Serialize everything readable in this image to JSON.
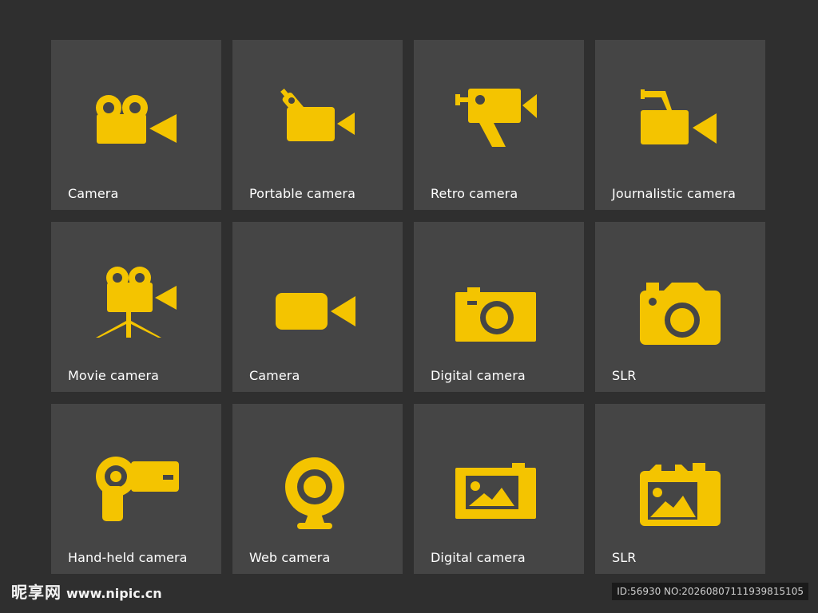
{
  "colors": {
    "background": "#2f2f2f",
    "tile": "#454545",
    "icon": "#f4c400",
    "label": "#ffffff"
  },
  "tiles": [
    {
      "label": "Camera",
      "icon": "movie-camera-icon"
    },
    {
      "label": "Portable camera",
      "icon": "portable-camera-icon"
    },
    {
      "label": "Retro camera",
      "icon": "retro-camera-icon"
    },
    {
      "label": "Journalistic camera",
      "icon": "journalistic-camera-icon"
    },
    {
      "label": "Movie camera",
      "icon": "movie-camera-tripod-icon"
    },
    {
      "label": "Camera",
      "icon": "video-camera-icon"
    },
    {
      "label": "Digital camera",
      "icon": "digital-camera-icon"
    },
    {
      "label": "SLR",
      "icon": "slr-camera-icon"
    },
    {
      "label": "Hand-held camera",
      "icon": "hand-held-camera-icon"
    },
    {
      "label": "Web camera",
      "icon": "web-camera-icon"
    },
    {
      "label": "Digital camera",
      "icon": "digital-camera-photo-icon"
    },
    {
      "label": "SLR",
      "icon": "slr-photo-icon"
    }
  ],
  "watermark": {
    "logo_cn": "昵享网",
    "site": "www.nipic.cn",
    "id_text": "ID:56930 NO:20260807111939815105"
  }
}
